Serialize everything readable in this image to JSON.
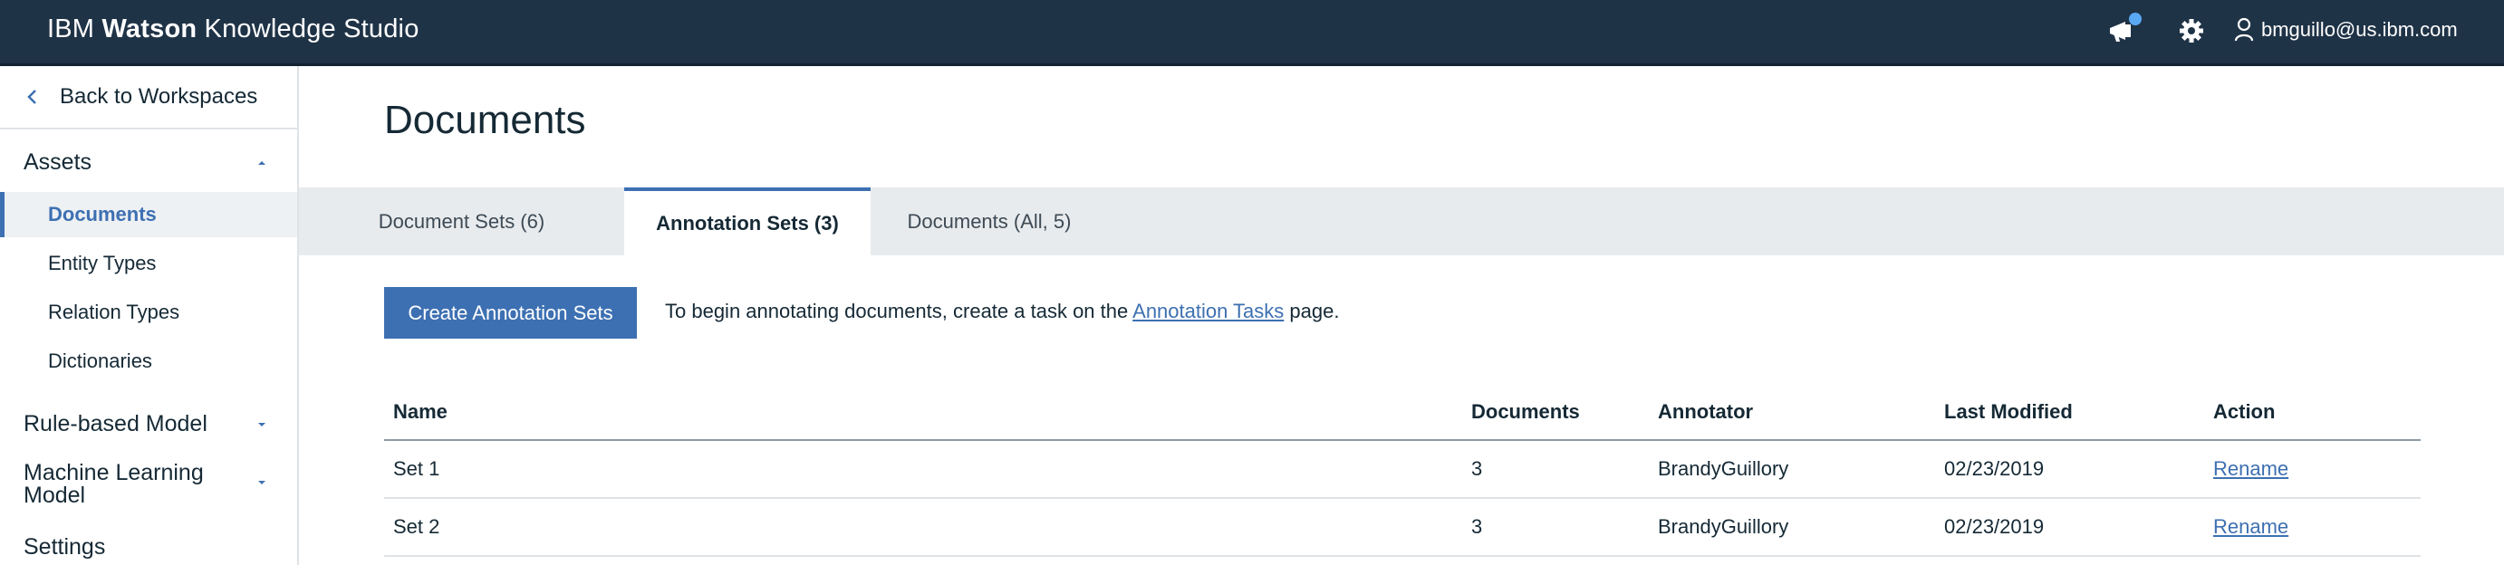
{
  "header": {
    "brand_prefix": "IBM",
    "brand_bold": "Watson",
    "brand_suffix": "Knowledge Studio",
    "user_email": "bmguillo@us.ibm.com",
    "icons": [
      "megaphone-icon",
      "gear-icon",
      "user-icon"
    ],
    "colors": {
      "background": "#1f3347",
      "notification": "#5aa9f5"
    }
  },
  "sidebar": {
    "back_label": "Back to Workspaces",
    "assets": {
      "label": "Assets",
      "items": [
        "Documents",
        "Entity Types",
        "Relation Types",
        "Dictionaries"
      ],
      "active": "Documents"
    },
    "rule_model": "Rule-based Model",
    "ml_model": "Machine Learning Model",
    "settings": "Settings"
  },
  "main": {
    "title": "Documents",
    "tabs": [
      "Document Sets (6)",
      "Annotation Sets (3)",
      "Documents (All, 5)"
    ],
    "active_tab": "Annotation Sets (3)",
    "create_button": "Create Annotation Sets",
    "hint_prefix": "To begin annotating documents, create a task on the",
    "hint_link": "Annotation Tasks",
    "hint_suffix": "page.",
    "table": {
      "columns": [
        "Name",
        "Documents",
        "Annotator",
        "Last Modified",
        "Action"
      ],
      "rows": [
        {
          "name": "Set 1",
          "documents": "3",
          "annotator": "BrandyGuillory",
          "modified": "02/23/2019",
          "action": "Rename"
        },
        {
          "name": "Set 2",
          "documents": "3",
          "annotator": "BrandyGuillory",
          "modified": "02/23/2019",
          "action": "Rename"
        }
      ]
    },
    "accent": "#3d70b2"
  }
}
